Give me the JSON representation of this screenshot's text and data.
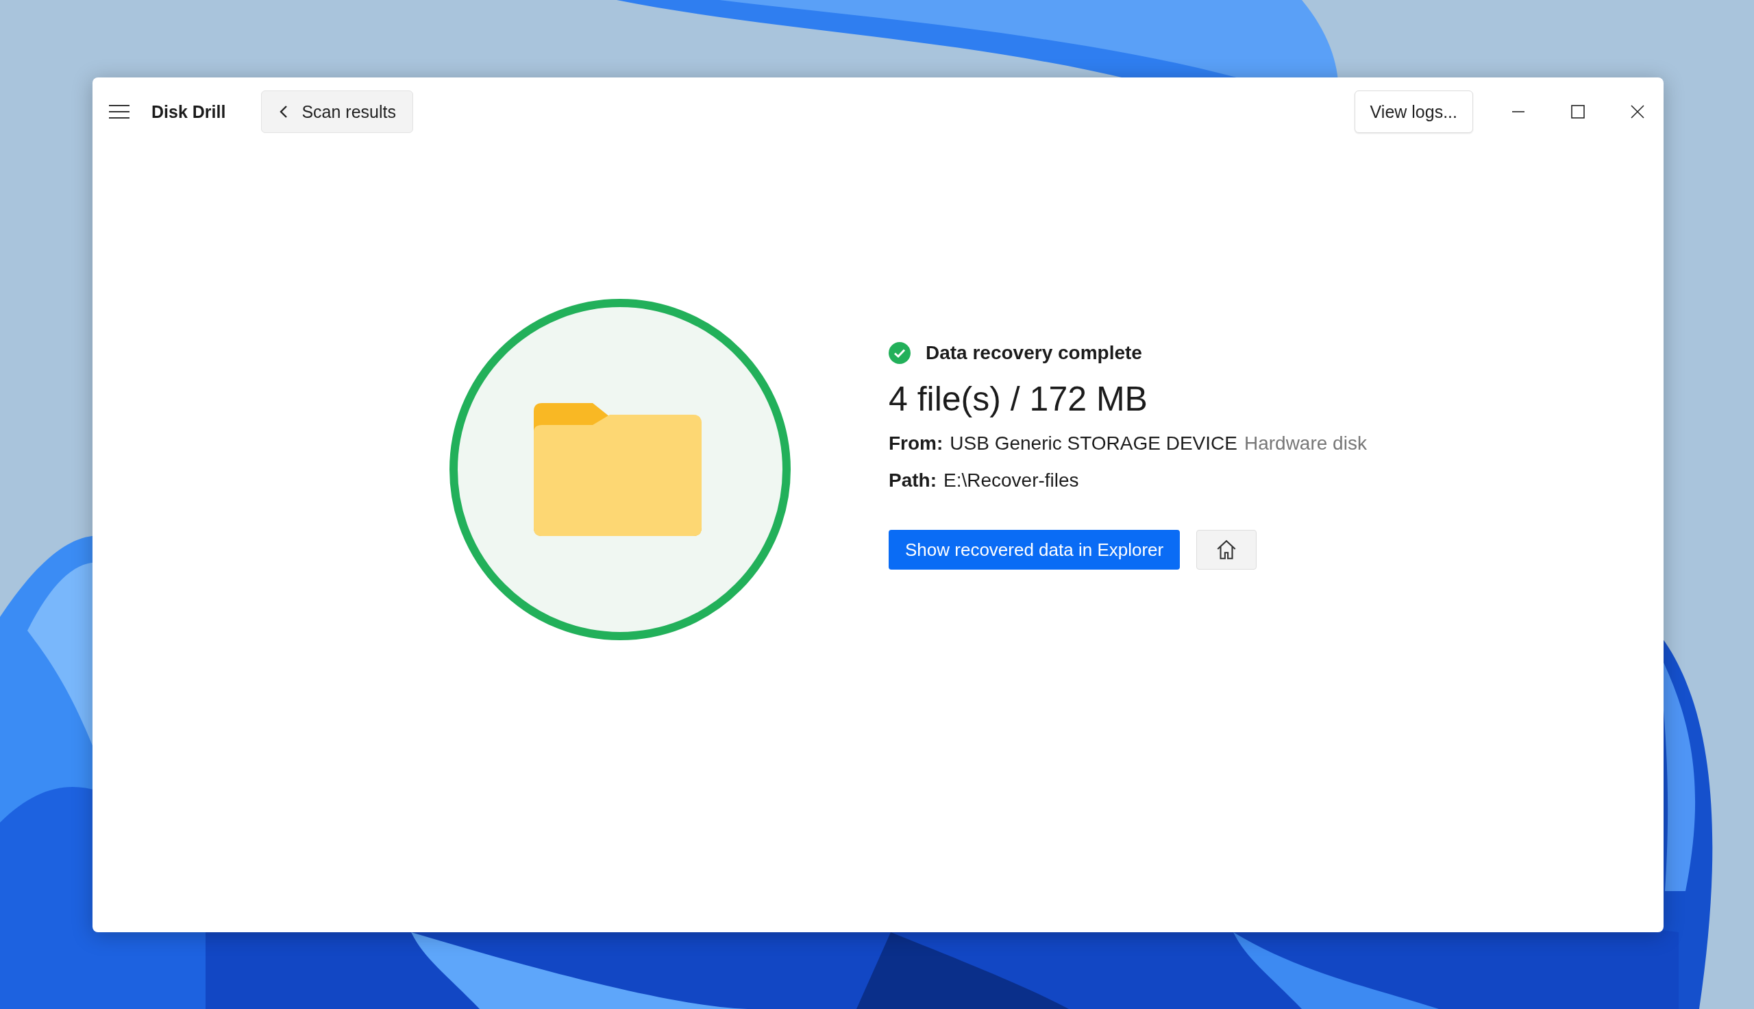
{
  "app": {
    "title": "Disk Drill",
    "back_button": "Scan results",
    "logs_button": "View logs..."
  },
  "result": {
    "status": "Data recovery complete",
    "summary": "4 file(s) / 172 MB",
    "from_label": "From:",
    "from_value": "USB Generic STORAGE DEVICE",
    "from_type": "Hardware disk",
    "path_label": "Path:",
    "path_value": "E:\\Recover-files",
    "primary_button": "Show recovered data in Explorer"
  }
}
